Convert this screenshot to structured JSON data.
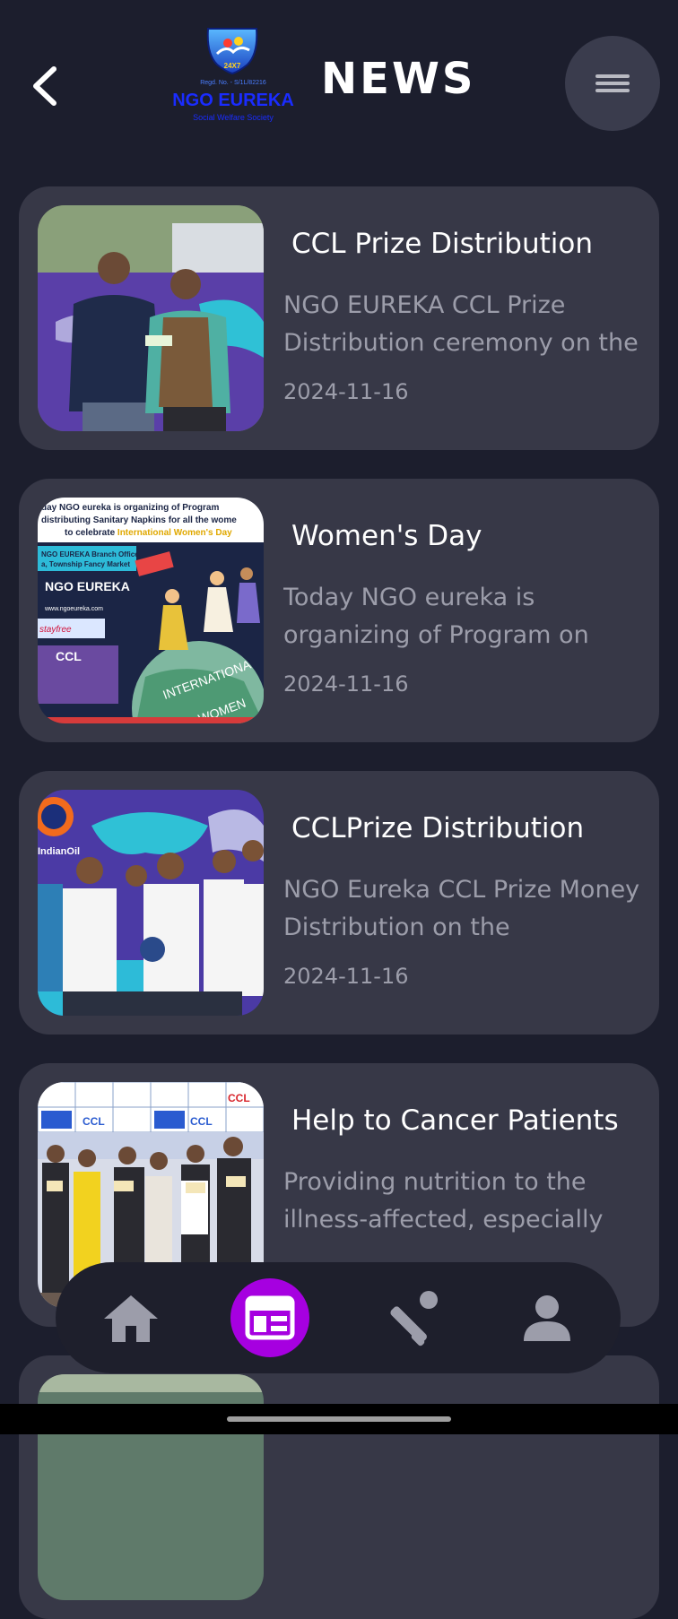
{
  "header": {
    "title": "NEWS",
    "logo": {
      "reg_text": "Regd. No. - S/1L/82216",
      "name": "NGO EUREKA",
      "tagline": "Social Welfare Society"
    }
  },
  "news": [
    {
      "title": "CCL Prize Distribution",
      "description": "NGO EUREKA CCL Prize Distribution ceremony on the",
      "date": "2024-11-16",
      "image_text": ""
    },
    {
      "title": "Women's Day",
      "description": "Today NGO eureka is organizing of Program on",
      "date": "2024-11-16",
      "image_text": "day NGO eureka is organizing of Program distributing Sanitary Napkins for all the women to celebrate International Women's Day"
    },
    {
      "title": "CCLPrize Distribution",
      "description": "NGO Eureka CCL Prize Money Distribution  on the",
      "date": "2024-11-16",
      "image_text": "IndianOil"
    },
    {
      "title": "Help to Cancer Patients",
      "description": "Providing nutrition to the illness-affected, especially",
      "date": "",
      "image_text": "CCL"
    }
  ],
  "nav": {
    "items": [
      "home-icon",
      "news-icon",
      "cricket-icon",
      "profile-icon"
    ],
    "active_index": 1
  },
  "colors": {
    "background": "#1c1e2d",
    "card": "#373847",
    "accent": "#a600e0",
    "muted_text": "#9c9daa"
  }
}
